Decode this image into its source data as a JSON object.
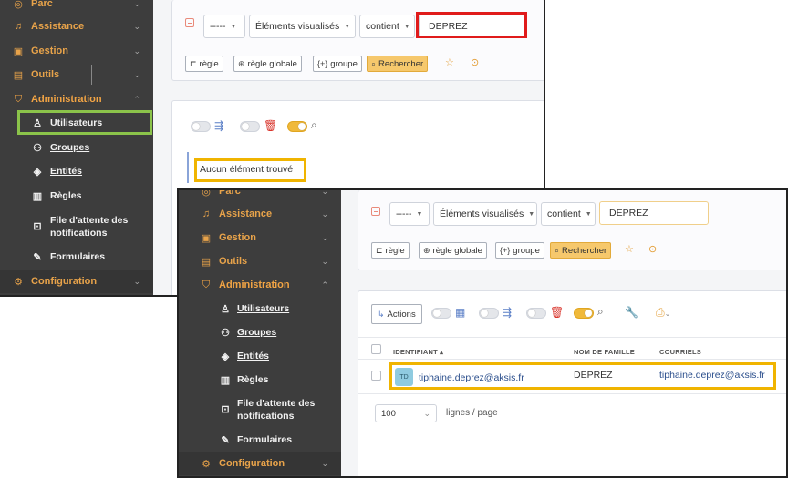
{
  "sidebar": {
    "parc": "Parc",
    "assistance": "Assistance",
    "gestion": "Gestion",
    "outils": "Outils",
    "administration": "Administration",
    "utilisateurs": "Utilisateurs",
    "groupes": "Groupes",
    "entites": "Entités",
    "regles": "Règles",
    "file_attente_line1": "File d'attente des",
    "file_attente_line2": "notifications",
    "formulaires": "Formulaires",
    "configuration": "Configuration"
  },
  "search": {
    "field_select": "-----",
    "items_select": "Éléments visualisés",
    "operator_select": "contient",
    "value": "DEPREZ"
  },
  "buttons": {
    "rule": "règle",
    "global_rule": "règle globale",
    "group": "groupe",
    "search": "Rechercher",
    "actions": "Actions"
  },
  "results_empty": "Aucun élément trouvé",
  "table": {
    "headers": {
      "identifier": "IDENTIFIANT",
      "last_name": "NOM DE FAMILLE",
      "emails": "COURRIELS"
    },
    "rows": [
      {
        "avatar": "TD",
        "identifier": "tiphaine.deprez@aksis.fr",
        "last_name": "DEPREZ",
        "email": "tiphaine.deprez@aksis.fr"
      }
    ]
  },
  "pagination": {
    "page_size": "100",
    "per_page_label": "lignes / page"
  },
  "colors": {
    "accent": "#e8a34a",
    "sidebar_bg": "#3d3d3d",
    "highlight_green": "#8bc34a",
    "highlight_red": "#e01b1b",
    "highlight_yellow": "#f0b400"
  }
}
